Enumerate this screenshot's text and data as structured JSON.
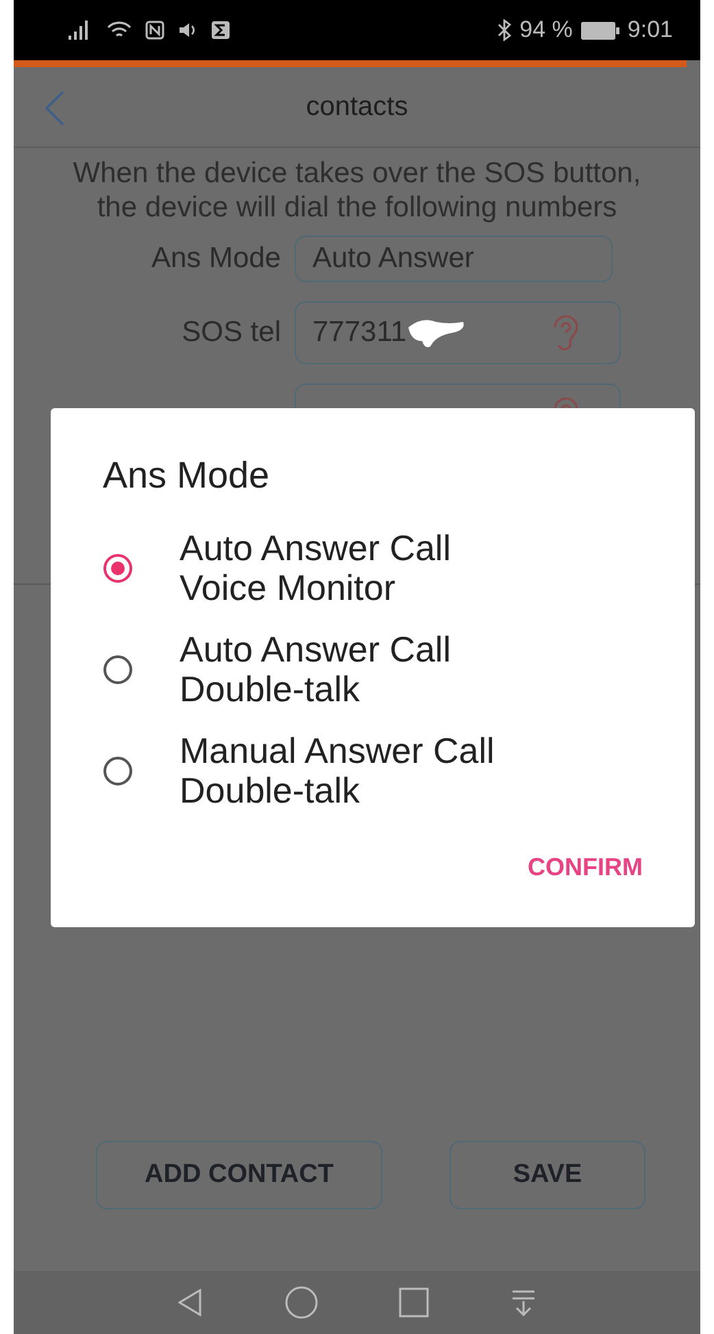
{
  "status_bar": {
    "battery": "94 %",
    "time": "9:01"
  },
  "loading_bar": {
    "level": 0.98
  },
  "header": {
    "title": "contacts"
  },
  "description": "When the device takes over the SOS button,\nthe device will dial the following numbers",
  "fields": [
    {
      "kind": "mode",
      "label": "Ans Mode",
      "value": "Auto Answer"
    },
    {
      "kind": "phone",
      "label": "SOS tel",
      "value": "777311"
    },
    {
      "kind": "phone"
    }
  ],
  "buttons": [
    "ADD CONTACT",
    "SAVE"
  ],
  "dialog": {
    "title": "Ans Mode",
    "options": [
      {
        "label": "Auto Answer Call\nVoice Monitor",
        "selected": true
      },
      {
        "label": "Auto Answer Call\nDouble-talk",
        "selected": false
      },
      {
        "label": "Manual Answer Call\nDouble-talk",
        "selected": false
      }
    ],
    "confirm": "CONFIRM"
  }
}
